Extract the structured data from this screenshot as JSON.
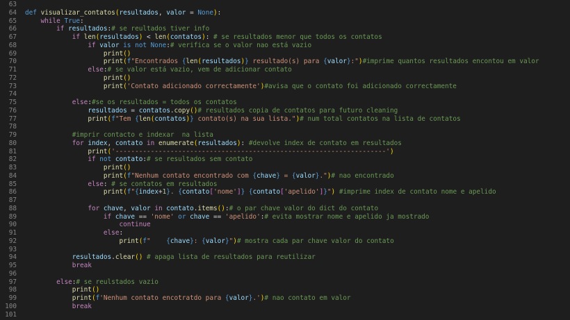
{
  "editor": {
    "language": "python",
    "colors": {
      "background": "#1e1e1e",
      "line_number": "#858585",
      "keyword": "#569cd6",
      "control": "#c586c0",
      "function": "#dcdcaa",
      "string": "#ce9178",
      "comment": "#6a9955",
      "number": "#b5cea8",
      "variable": "#9cdcfe",
      "text": "#d4d4d4"
    },
    "lines": [
      {
        "n": "63",
        "t": []
      },
      {
        "n": "64",
        "t": [
          [
            "kw",
            "def "
          ],
          [
            "fn",
            "visualizar_contatos"
          ],
          [
            "br1",
            "("
          ],
          [
            "var",
            "resultados"
          ],
          [
            "txt",
            ", "
          ],
          [
            "var",
            "valor"
          ],
          [
            "txt",
            " = "
          ],
          [
            "kw",
            "None"
          ],
          [
            "br1",
            ")"
          ],
          [
            "txt",
            ":"
          ]
        ]
      },
      {
        "n": "65",
        "t": [
          [
            "txt",
            "    "
          ],
          [
            "ctl",
            "while "
          ],
          [
            "kw",
            "True"
          ],
          [
            "txt",
            ":"
          ]
        ]
      },
      {
        "n": "66",
        "t": [
          [
            "txt",
            "        "
          ],
          [
            "ctl",
            "if "
          ],
          [
            "var",
            "resultados"
          ],
          [
            "txt",
            ":"
          ],
          [
            "cm",
            "# se reultados tiver info"
          ]
        ]
      },
      {
        "n": "67",
        "t": [
          [
            "txt",
            "            "
          ],
          [
            "ctl",
            "if "
          ],
          [
            "fn",
            "len"
          ],
          [
            "br1",
            "("
          ],
          [
            "var",
            "resultados"
          ],
          [
            "br1",
            ")"
          ],
          [
            "txt",
            " < "
          ],
          [
            "fn",
            "len"
          ],
          [
            "br1",
            "("
          ],
          [
            "var",
            "contatos"
          ],
          [
            "br1",
            ")"
          ],
          [
            "txt",
            ": "
          ],
          [
            "cm",
            "# se resultados menor que todos os contatos"
          ]
        ]
      },
      {
        "n": "68",
        "t": [
          [
            "txt",
            "                "
          ],
          [
            "ctl",
            "if "
          ],
          [
            "var",
            "valor"
          ],
          [
            "txt",
            " "
          ],
          [
            "kw",
            "is not None"
          ],
          [
            "txt",
            ":"
          ],
          [
            "cm",
            "# verifica se o valor nao está vazio"
          ]
        ]
      },
      {
        "n": "69",
        "t": [
          [
            "txt",
            "                    "
          ],
          [
            "fn",
            "print"
          ],
          [
            "br1",
            "()"
          ]
        ]
      },
      {
        "n": "70",
        "t": [
          [
            "txt",
            "                    "
          ],
          [
            "fn",
            "print"
          ],
          [
            "br1",
            "("
          ],
          [
            "kw",
            "f"
          ],
          [
            "str",
            "\"Encontrados "
          ],
          [
            "kw",
            "{"
          ],
          [
            "fn",
            "len"
          ],
          [
            "br1",
            "("
          ],
          [
            "var",
            "resultados"
          ],
          [
            "br1",
            ")"
          ],
          [
            "kw",
            "}"
          ],
          [
            "str",
            " resultado(s) para "
          ],
          [
            "kw",
            "{"
          ],
          [
            "var",
            "valor"
          ],
          [
            "kw",
            "}"
          ],
          [
            "str",
            ":\""
          ],
          [
            "br1",
            ")"
          ],
          [
            "cm",
            "#imprime quantos resultados encontou em valor"
          ]
        ]
      },
      {
        "n": "71",
        "t": [
          [
            "txt",
            "                "
          ],
          [
            "ctl",
            "else"
          ],
          [
            "txt",
            ":"
          ],
          [
            "cm",
            "# se valor está vazio, vem de adicionar contato"
          ]
        ]
      },
      {
        "n": "72",
        "t": [
          [
            "txt",
            "                    "
          ],
          [
            "fn",
            "print"
          ],
          [
            "br1",
            "()"
          ]
        ]
      },
      {
        "n": "73",
        "t": [
          [
            "txt",
            "                    "
          ],
          [
            "fn",
            "print"
          ],
          [
            "br1",
            "("
          ],
          [
            "str",
            "'Contato adicionado correctamente'"
          ],
          [
            "br1",
            ")"
          ],
          [
            "cm",
            "#avisa que o contato foi adicionado correctamente"
          ]
        ]
      },
      {
        "n": "74",
        "t": []
      },
      {
        "n": "75",
        "t": [
          [
            "txt",
            "            "
          ],
          [
            "ctl",
            "else"
          ],
          [
            "txt",
            ":"
          ],
          [
            "cm",
            "#se os resultados = todos os contatos"
          ]
        ]
      },
      {
        "n": "76",
        "t": [
          [
            "txt",
            "                "
          ],
          [
            "var",
            "resultados"
          ],
          [
            "txt",
            " = "
          ],
          [
            "var",
            "contatos"
          ],
          [
            "txt",
            "."
          ],
          [
            "fn",
            "copy"
          ],
          [
            "br1",
            "()"
          ],
          [
            "cm",
            "# resultados copia de contatos para futuro cleaning"
          ]
        ]
      },
      {
        "n": "77",
        "t": [
          [
            "txt",
            "                "
          ],
          [
            "fn",
            "print"
          ],
          [
            "br1",
            "("
          ],
          [
            "kw",
            "f"
          ],
          [
            "str",
            "\"Tem "
          ],
          [
            "kw",
            "{"
          ],
          [
            "fn",
            "len"
          ],
          [
            "br1",
            "("
          ],
          [
            "var",
            "contatos"
          ],
          [
            "br1",
            ")"
          ],
          [
            "kw",
            "}"
          ],
          [
            "str",
            " contato(s) na sua lista.\""
          ],
          [
            "br1",
            ")"
          ],
          [
            "cm",
            "# num total contatos na lista de contatos"
          ]
        ]
      },
      {
        "n": "78",
        "t": []
      },
      {
        "n": "79",
        "t": [
          [
            "txt",
            "            "
          ],
          [
            "cm",
            "#imprir contacto e indexar  na lista"
          ]
        ]
      },
      {
        "n": "80",
        "t": [
          [
            "txt",
            "            "
          ],
          [
            "ctl",
            "for "
          ],
          [
            "var",
            "index"
          ],
          [
            "txt",
            ", "
          ],
          [
            "var",
            "contato"
          ],
          [
            "txt",
            " "
          ],
          [
            "ctl",
            "in "
          ],
          [
            "fn",
            "enumerate"
          ],
          [
            "br1",
            "("
          ],
          [
            "var",
            "resultados"
          ],
          [
            "br1",
            ")"
          ],
          [
            "txt",
            ": "
          ],
          [
            "cm",
            "#devolve index de contato em resultados"
          ]
        ]
      },
      {
        "n": "81",
        "t": [
          [
            "txt",
            "                "
          ],
          [
            "fn",
            "print"
          ],
          [
            "br1",
            "("
          ],
          [
            "str",
            "'---------------------------------------------------------------------'"
          ],
          [
            "br1",
            ")"
          ]
        ]
      },
      {
        "n": "82",
        "t": [
          [
            "txt",
            "                "
          ],
          [
            "ctl",
            "if "
          ],
          [
            "kw",
            "not "
          ],
          [
            "var",
            "contato"
          ],
          [
            "txt",
            ":"
          ],
          [
            "cm",
            "# se resultados sem contato"
          ]
        ]
      },
      {
        "n": "83",
        "t": [
          [
            "txt",
            "                    "
          ],
          [
            "fn",
            "print"
          ],
          [
            "br1",
            "()"
          ]
        ]
      },
      {
        "n": "84",
        "t": [
          [
            "txt",
            "                    "
          ],
          [
            "fn",
            "print"
          ],
          [
            "br1",
            "("
          ],
          [
            "kw",
            "f"
          ],
          [
            "str",
            "\"Nenhum contato encontrado com "
          ],
          [
            "kw",
            "{"
          ],
          [
            "var",
            "chave"
          ],
          [
            "kw",
            "}"
          ],
          [
            "str",
            " = "
          ],
          [
            "kw",
            "{"
          ],
          [
            "var",
            "valor"
          ],
          [
            "kw",
            "}"
          ],
          [
            "str",
            ".\""
          ],
          [
            "br1",
            ")"
          ],
          [
            "cm",
            "# nao encontrado"
          ]
        ]
      },
      {
        "n": "85",
        "t": [
          [
            "txt",
            "                "
          ],
          [
            "ctl",
            "else"
          ],
          [
            "txt",
            ": "
          ],
          [
            "cm",
            "# se contatos em resultados"
          ]
        ]
      },
      {
        "n": "86",
        "t": [
          [
            "txt",
            "                    "
          ],
          [
            "fn",
            "print"
          ],
          [
            "br1",
            "("
          ],
          [
            "kw",
            "f"
          ],
          [
            "str",
            "\""
          ],
          [
            "kw",
            "{"
          ],
          [
            "var",
            "index"
          ],
          [
            "txt",
            "+"
          ],
          [
            "num",
            "1"
          ],
          [
            "kw",
            "}"
          ],
          [
            "str",
            ". "
          ],
          [
            "kw",
            "{"
          ],
          [
            "var",
            "contato"
          ],
          [
            "br2",
            "["
          ],
          [
            "str",
            "'nome'"
          ],
          [
            "br2",
            "]"
          ],
          [
            "kw",
            "}"
          ],
          [
            "str",
            " "
          ],
          [
            "kw",
            "{"
          ],
          [
            "var",
            "contato"
          ],
          [
            "br2",
            "["
          ],
          [
            "str",
            "'apelido'"
          ],
          [
            "br2",
            "]"
          ],
          [
            "kw",
            "}"
          ],
          [
            "str",
            "\""
          ],
          [
            "br1",
            ")"
          ],
          [
            "txt",
            " "
          ],
          [
            "cm",
            "#imprime index de contato nome e apelido"
          ]
        ]
      },
      {
        "n": "87",
        "t": []
      },
      {
        "n": "88",
        "t": [
          [
            "txt",
            "                "
          ],
          [
            "ctl",
            "for "
          ],
          [
            "var",
            "chave"
          ],
          [
            "txt",
            ", "
          ],
          [
            "var",
            "valor"
          ],
          [
            "txt",
            " "
          ],
          [
            "ctl",
            "in "
          ],
          [
            "var",
            "contato"
          ],
          [
            "txt",
            "."
          ],
          [
            "fn",
            "items"
          ],
          [
            "br1",
            "()"
          ],
          [
            "txt",
            ":"
          ],
          [
            "cm",
            "# o par chave valor do dict do contato"
          ]
        ]
      },
      {
        "n": "89",
        "t": [
          [
            "txt",
            "                    "
          ],
          [
            "ctl",
            "if "
          ],
          [
            "var",
            "chave"
          ],
          [
            "txt",
            " == "
          ],
          [
            "str",
            "'nome'"
          ],
          [
            "txt",
            " "
          ],
          [
            "kw",
            "or "
          ],
          [
            "var",
            "chave"
          ],
          [
            "txt",
            " == "
          ],
          [
            "str",
            "'apelido'"
          ],
          [
            "txt",
            ":"
          ],
          [
            "cm",
            "# evita mostrar nome e apelido ja mostrado"
          ]
        ]
      },
      {
        "n": "90",
        "t": [
          [
            "txt",
            "                        "
          ],
          [
            "ctl",
            "continue"
          ]
        ]
      },
      {
        "n": "91",
        "t": [
          [
            "txt",
            "                    "
          ],
          [
            "ctl",
            "else"
          ],
          [
            "txt",
            ":"
          ]
        ]
      },
      {
        "n": "92",
        "t": [
          [
            "txt",
            "                        "
          ],
          [
            "fn",
            "print"
          ],
          [
            "br1",
            "("
          ],
          [
            "kw",
            "f"
          ],
          [
            "str",
            "\"    "
          ],
          [
            "kw",
            "{"
          ],
          [
            "var",
            "chave"
          ],
          [
            "kw",
            "}"
          ],
          [
            "str",
            ": "
          ],
          [
            "kw",
            "{"
          ],
          [
            "var",
            "valor"
          ],
          [
            "kw",
            "}"
          ],
          [
            "str",
            "\""
          ],
          [
            "br1",
            ")"
          ],
          [
            "cm",
            "# mostra cada par chave valor do contato"
          ]
        ]
      },
      {
        "n": "93",
        "t": []
      },
      {
        "n": "94",
        "t": [
          [
            "txt",
            "            "
          ],
          [
            "var",
            "resultados"
          ],
          [
            "txt",
            "."
          ],
          [
            "fn",
            "clear"
          ],
          [
            "br1",
            "()"
          ],
          [
            "txt",
            " "
          ],
          [
            "cm",
            "# apaga lista de resultados para reutilizar"
          ]
        ]
      },
      {
        "n": "95",
        "t": [
          [
            "txt",
            "            "
          ],
          [
            "ctl",
            "break"
          ]
        ]
      },
      {
        "n": "96",
        "t": []
      },
      {
        "n": "97",
        "t": [
          [
            "txt",
            "        "
          ],
          [
            "ctl",
            "else"
          ],
          [
            "txt",
            ":"
          ],
          [
            "cm",
            "# se reulstados vazio"
          ]
        ]
      },
      {
        "n": "98",
        "t": [
          [
            "txt",
            "            "
          ],
          [
            "fn",
            "print"
          ],
          [
            "br1",
            "()"
          ]
        ]
      },
      {
        "n": "99",
        "t": [
          [
            "txt",
            "            "
          ],
          [
            "fn",
            "print"
          ],
          [
            "br1",
            "("
          ],
          [
            "kw",
            "f"
          ],
          [
            "str",
            "'Nenhum contato encotratdo para "
          ],
          [
            "kw",
            "{"
          ],
          [
            "var",
            "valor"
          ],
          [
            "kw",
            "}"
          ],
          [
            "str",
            ".'"
          ],
          [
            "br1",
            ")"
          ],
          [
            "cm",
            "# nao contato em valor"
          ]
        ]
      },
      {
        "n": "100",
        "t": [
          [
            "txt",
            "            "
          ],
          [
            "ctl",
            "break"
          ]
        ]
      },
      {
        "n": "101",
        "t": []
      }
    ]
  }
}
